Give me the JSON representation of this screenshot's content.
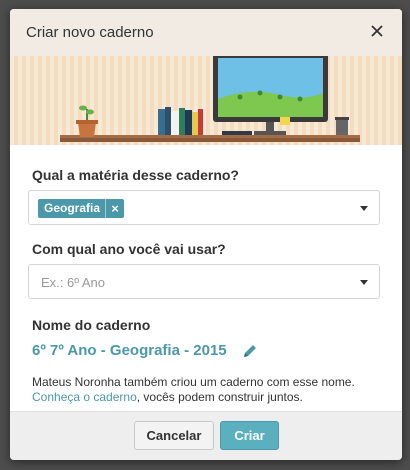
{
  "modal": {
    "title": "Criar novo caderno",
    "close_icon": "close-icon"
  },
  "subject_field": {
    "label": "Qual a matéria desse caderno?",
    "selected_tag": "Geografia",
    "remove_glyph": "×"
  },
  "year_field": {
    "label": "Com qual ano você vai usar?",
    "placeholder": "Ex.: 6º Ano"
  },
  "name_field": {
    "label": "Nome do caderno",
    "value": "6º 7º Ano - Geografia - 2015",
    "edit_icon": "pencil-icon"
  },
  "info": {
    "line1": "Mateus Noronha também criou um caderno com esse nome.",
    "link": "Conheça o caderno",
    "line2_rest": ", vocês podem construir juntos."
  },
  "footer": {
    "cancel_label": "Cancelar",
    "create_label": "Criar"
  },
  "colors": {
    "accent": "#4a98a9",
    "primary_button": "#5ab0bf",
    "header_bg": "#f1ebe3",
    "illustration_bg": "#f8e9d4"
  }
}
